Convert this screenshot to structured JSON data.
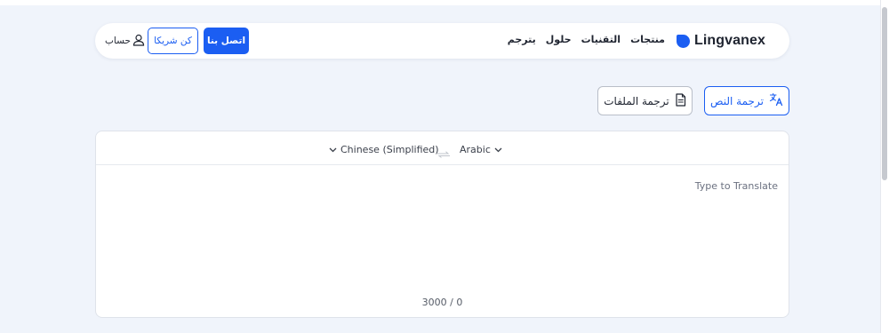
{
  "header": {
    "logo_text": "Lingvanex",
    "nav": [
      "منتجات",
      "التقنيات",
      "حلول",
      "يترجم"
    ],
    "contact_label": "اتصل بنا",
    "partner_label": "كن شريكا",
    "account_label": "حساب"
  },
  "modes": {
    "text_label": "ترجمة النص",
    "files_label": "ترجمة الملفات"
  },
  "translator": {
    "source_lang": "Chinese (Simplified)",
    "target_lang": "Arabic",
    "placeholder": "Type to Translate",
    "counter": "3000 / 0"
  },
  "colors": {
    "accent": "#1b5ef2",
    "background": "#f0f4fb"
  }
}
